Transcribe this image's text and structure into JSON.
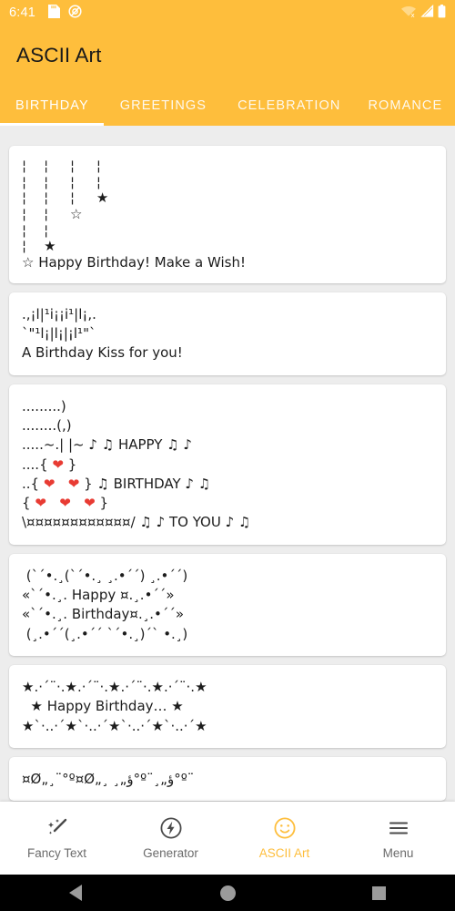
{
  "statusbar": {
    "time": "6:41",
    "icons": [
      "sd-card-icon",
      "do-not-disturb-icon"
    ],
    "right_icons": [
      "wifi-off-icon",
      "cellular-signal-icon",
      "battery-icon"
    ]
  },
  "appbar": {
    "title": "ASCII Art",
    "accent_color": "#FEBE3C",
    "title_color": "#1a1a1a"
  },
  "tabs": [
    {
      "label": "BIRTHDAY",
      "active": true
    },
    {
      "label": "GREETINGS",
      "active": false
    },
    {
      "label": "CELEBRATION",
      "active": false
    },
    {
      "label": "ROMANCE",
      "active": false
    }
  ],
  "cards": [
    {
      "name": "ascii-art-card-hanging-stars",
      "lines": [
        "¦    ¦     ¦     ¦",
        "¦    ¦     ¦     ¦",
        "¦    ¦     ¦     ★",
        "¦    ¦     ☆",
        "¦    ¦",
        "¦    ★",
        "☆ Happy Birthday! Make a Wish!"
      ]
    },
    {
      "name": "ascii-art-card-birthday-kiss",
      "lines": [
        ".,¡l|¹i¡¡i¹|l¡,.",
        "`\"¹l¡|l¡|¡l¹\"`",
        "A Birthday Kiss for you!"
      ]
    },
    {
      "name": "ascii-art-card-heart-cake",
      "lines": [
        ".........)",
        "........(,)",
        ".....~.| |~ ♪ ♫ HAPPY ♫ ♪",
        "....{ ❤ }",
        "..{ ❤   ❤ } ♫ BIRTHDAY ♪ ♫",
        "{ ❤   ❤   ❤ }",
        "\\¤¤¤¤¤¤¤¤¤¤¤¤/ ♫ ♪ TO YOU ♪ ♫"
      ]
    },
    {
      "name": "ascii-art-card-butterfly-frame",
      "lines": [
        " (`´•.¸(`´•.¸ ¸.•´´) ¸.•´´)",
        "«`´•.¸. Happy ¤.¸.•´´»",
        "«`´•.¸. Birthday¤.¸.•´´»",
        " (¸.•´´(¸.•´´ `´•.¸)´` •.¸)"
      ]
    },
    {
      "name": "ascii-art-card-star-border",
      "lines": [
        "★.·´¨·.★.·´¨·.★.·´¨·.★.·´¨·.★",
        "  ★ Happy Birthday… ★",
        "★`·..·´★`·..·´★`·..·´★`·..·´★"
      ]
    },
    {
      "name": "ascii-art-card-wave-border",
      "lines": [
        "¤Ø„¸¨°º¤Ø„¸ ¸„ؤ°º¨¸„ؤ°º¨"
      ]
    }
  ],
  "bottomnav": [
    {
      "label": "Fancy Text",
      "icon": "magic-wand-icon",
      "active": false
    },
    {
      "label": "Generator",
      "icon": "lightning-circle-icon",
      "active": false
    },
    {
      "label": "ASCII Art",
      "icon": "smiley-face-icon",
      "active": true
    },
    {
      "label": "Menu",
      "icon": "hamburger-menu-icon",
      "active": false
    }
  ],
  "sysnav": [
    "back-button",
    "home-button",
    "recents-button"
  ]
}
